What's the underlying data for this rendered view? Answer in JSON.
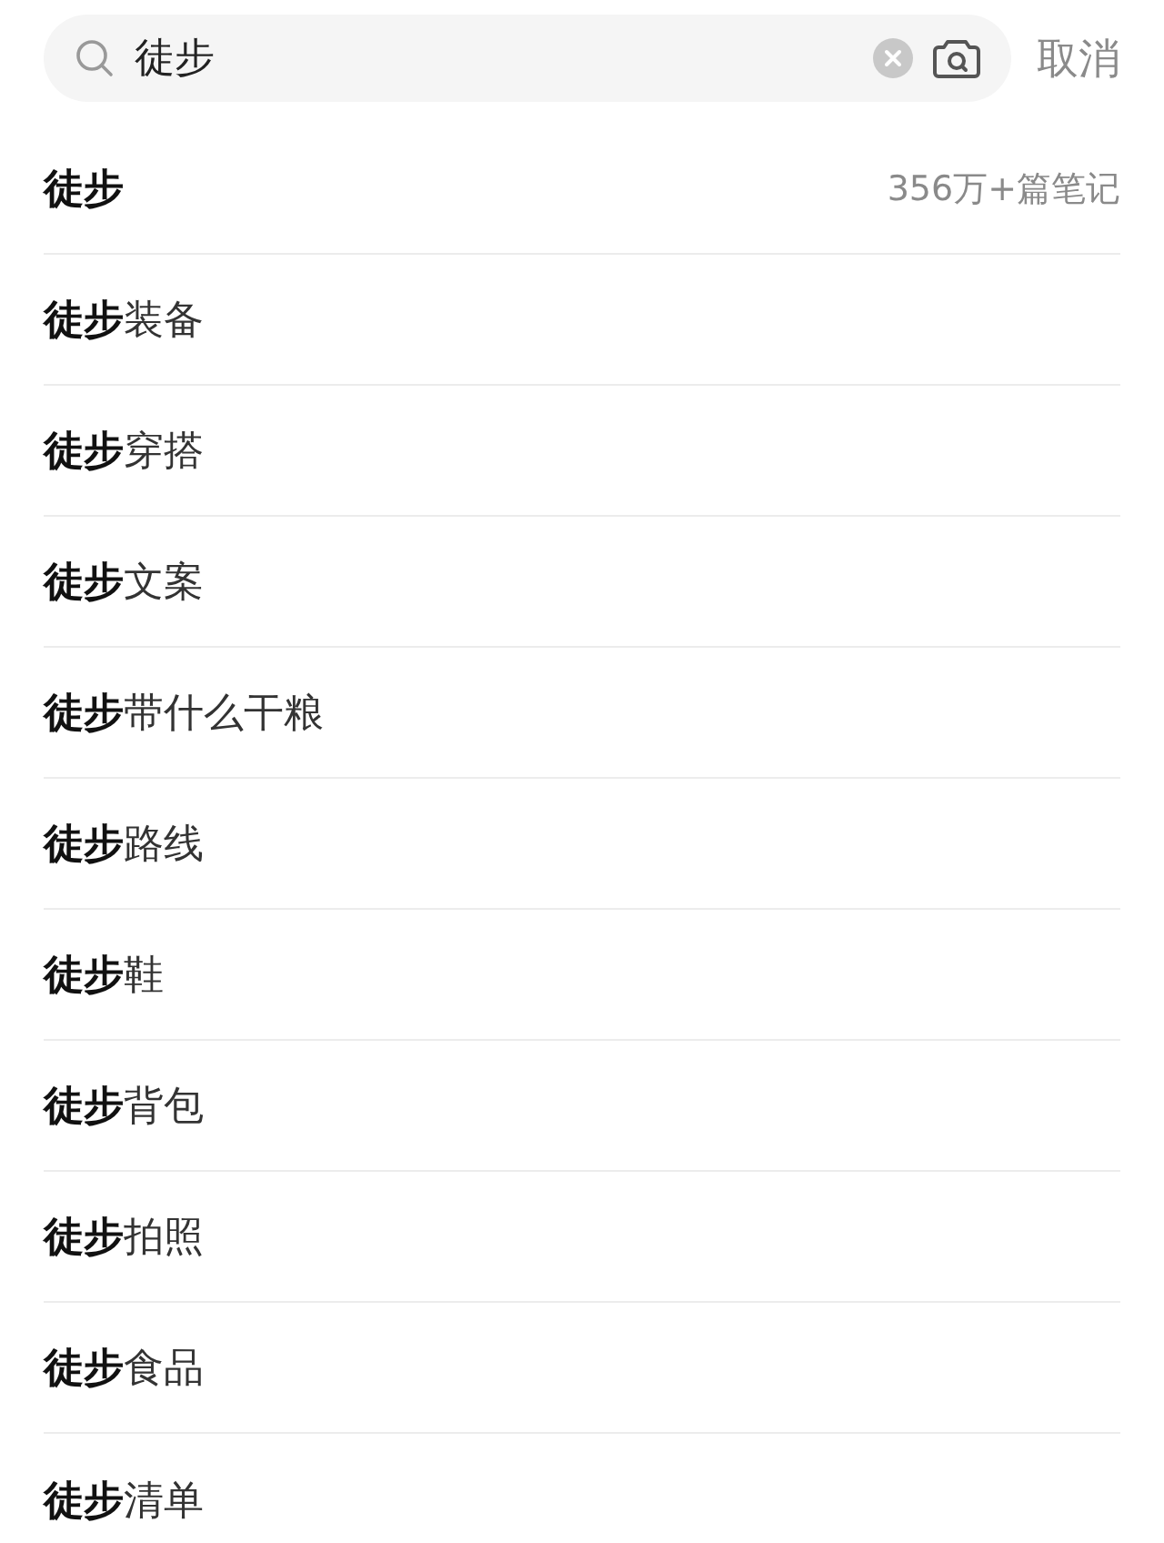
{
  "search": {
    "value": "徒步"
  },
  "cancel": "取消",
  "suggestions": [
    {
      "text": "**徒步**",
      "count": "356万+篇笔记"
    },
    {
      "text": "**徒步**装备"
    },
    {
      "text": "**徒步**穿搭"
    },
    {
      "text": "**徒步**文案"
    },
    {
      "text": "**徒步**带什么干粮"
    },
    {
      "text": "**徒步**路线"
    },
    {
      "text": "**徒步**鞋"
    },
    {
      "text": "**徒步**背包"
    },
    {
      "text": "**徒步**拍照"
    },
    {
      "text": "**徒步**食品"
    },
    {
      "text": "**徒步**清单"
    }
  ]
}
